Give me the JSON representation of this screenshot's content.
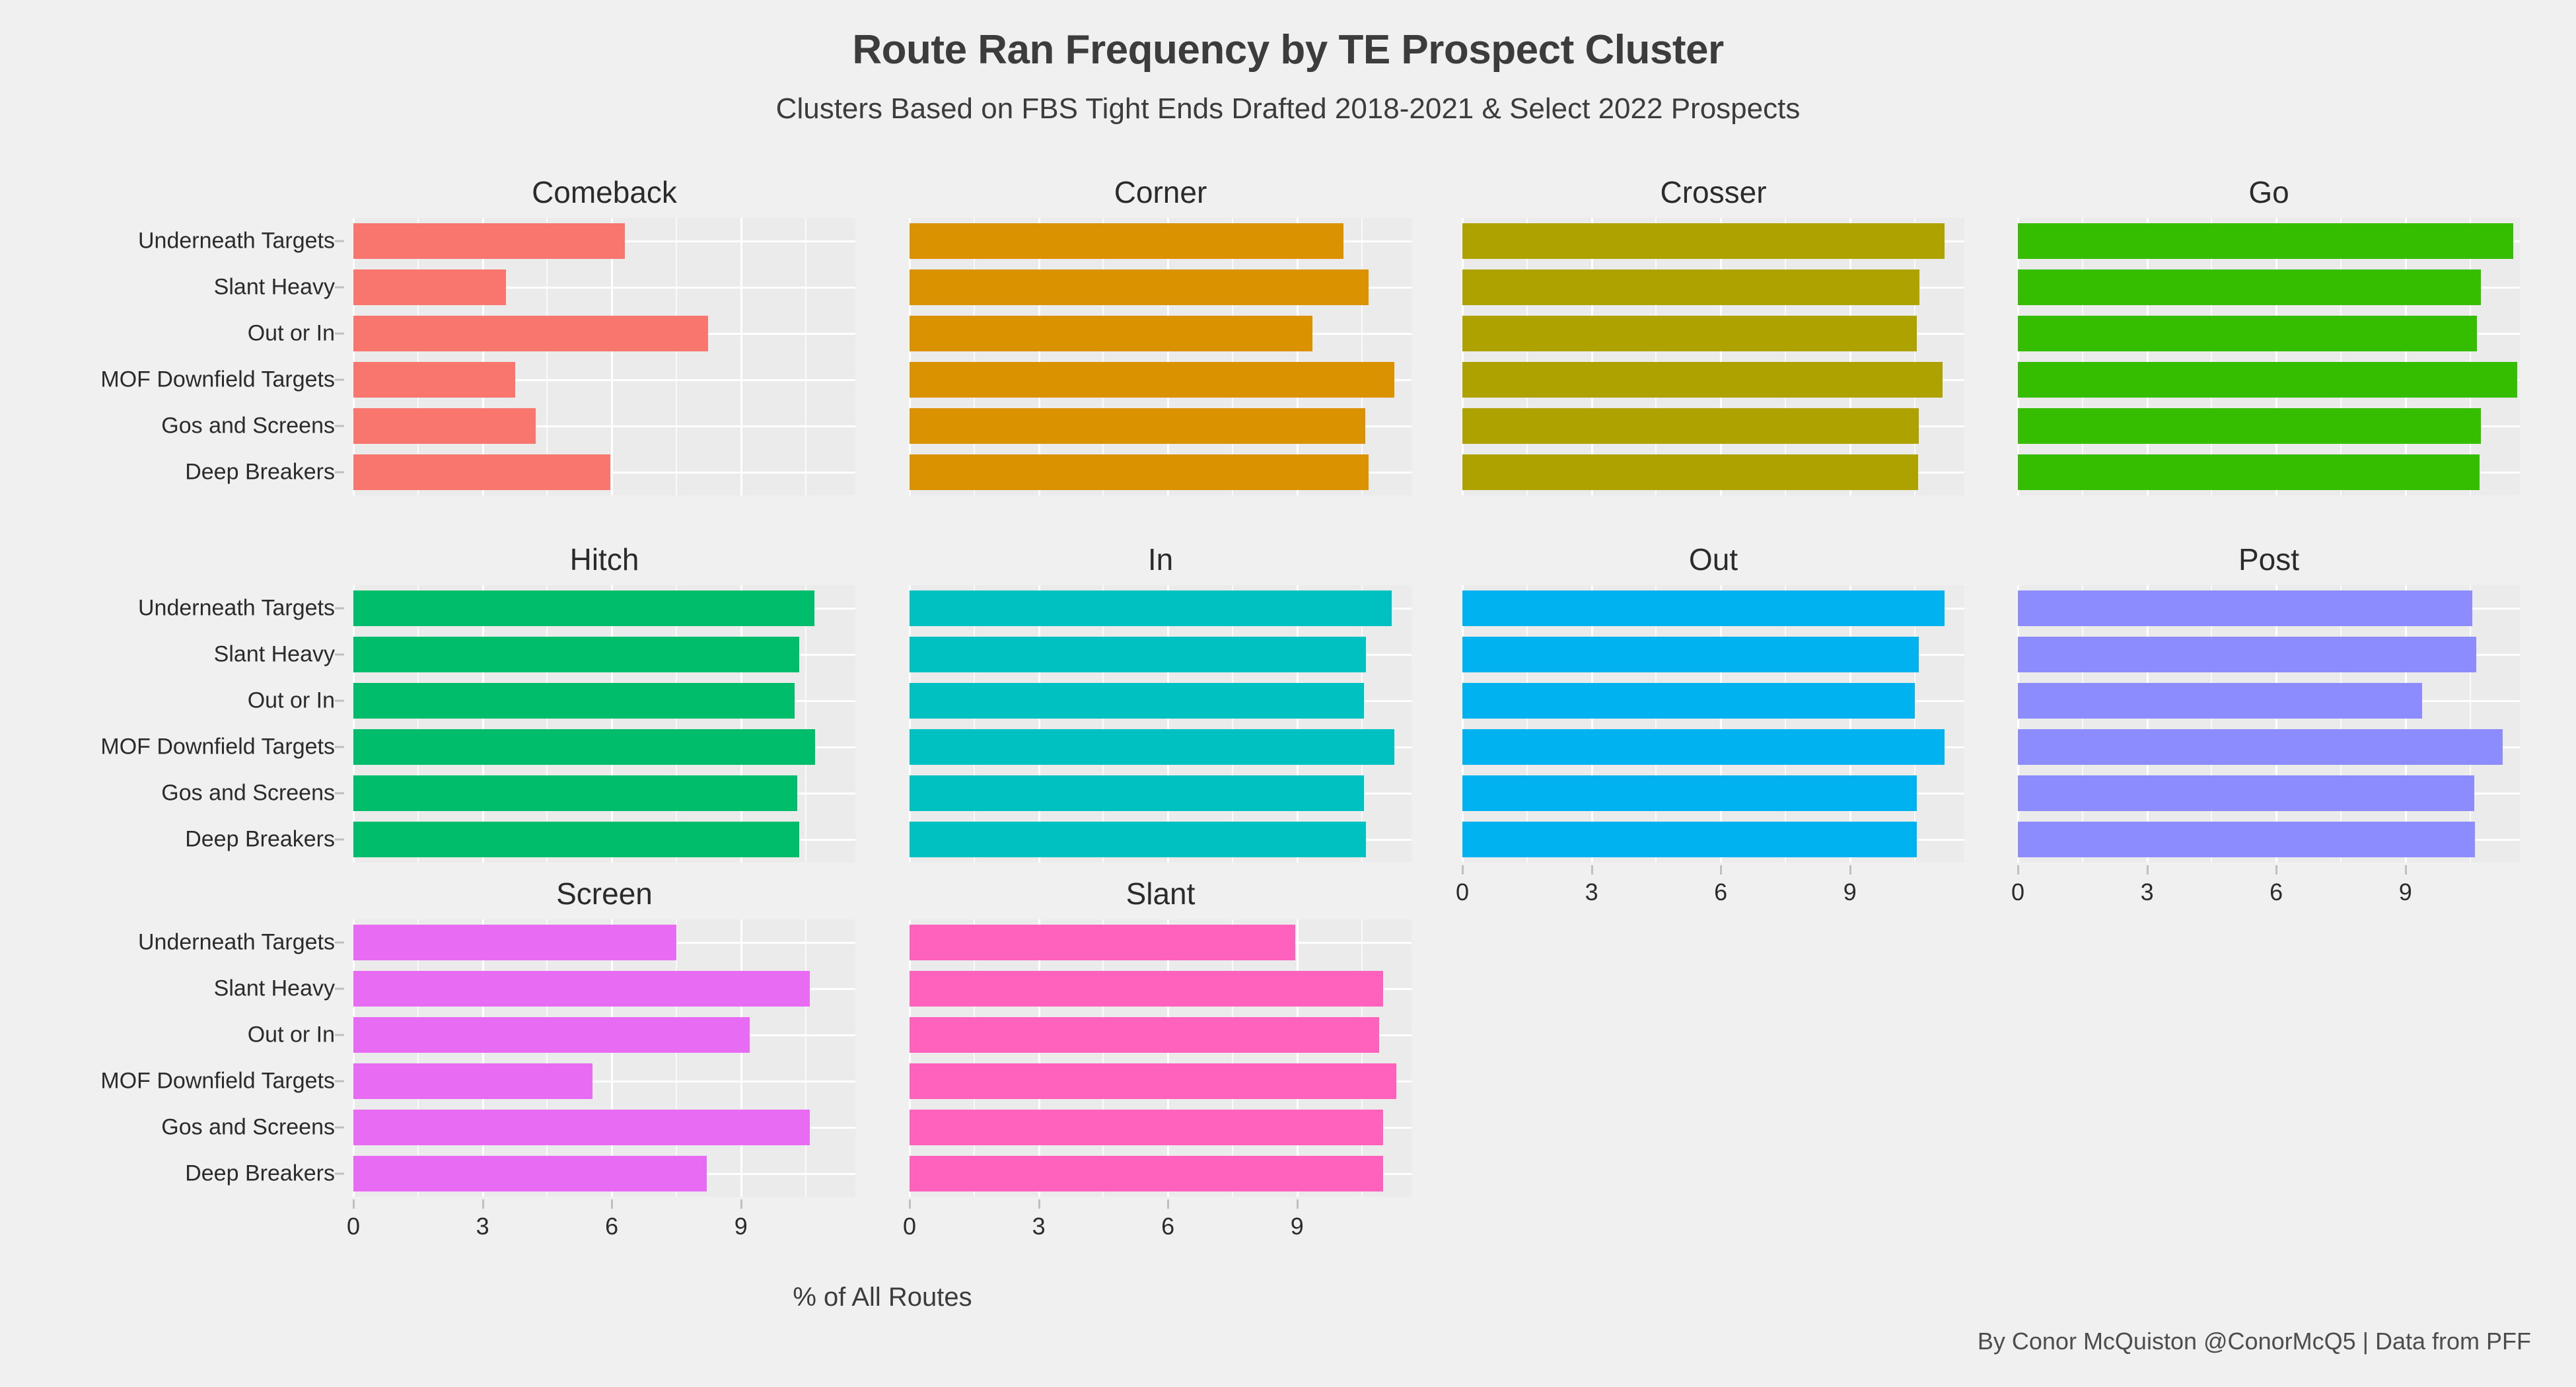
{
  "header": {
    "title": "Route Ran Frequency by TE Prospect Cluster",
    "subtitle": "Clusters Based on FBS Tight Ends Drafted 2018-2021 & Select 2022 Prospects"
  },
  "footer": {
    "caption": "By Conor McQuiston @ConorMcQ5 | Data from PFF"
  },
  "axis": {
    "xlabel": "% of All Routes",
    "ticks": [
      "0",
      "3",
      "6",
      "9"
    ],
    "tick_values": [
      0,
      3,
      6,
      9
    ]
  },
  "chart_data": {
    "type": "bar",
    "orientation": "horizontal",
    "title": "Route Ran Frequency by TE Prospect Cluster",
    "subtitle": "Clusters Based on FBS Tight Ends Drafted 2018-2021 & Select 2022 Prospects",
    "xlabel": "% of All Routes",
    "ylabel": "",
    "xlim": [
      0,
      11.8
    ],
    "xticks": [
      0,
      3,
      6,
      9
    ],
    "grid": true,
    "legend": false,
    "facet_layout": [
      3,
      4
    ],
    "categories": [
      "Underneath Targets",
      "Slant Heavy",
      "Out or In",
      "MOF Downfield Targets",
      "Gos and Screens",
      "Deep Breakers"
    ],
    "panels": [
      {
        "name": "Comeback",
        "color": "#F8766D",
        "row": 0,
        "col": 0,
        "values": [
          6.31,
          3.54,
          8.23,
          3.75,
          4.24,
          5.96
        ]
      },
      {
        "name": "Corner",
        "color": "#DB9200",
        "row": 0,
        "col": 1,
        "values": [
          10.08,
          10.66,
          9.35,
          11.26,
          10.58,
          10.66
        ]
      },
      {
        "name": "Crosser",
        "color": "#AEA200",
        "row": 0,
        "col": 2,
        "values": [
          11.2,
          10.62,
          10.55,
          11.15,
          10.6,
          10.58
        ]
      },
      {
        "name": "Go",
        "color": "#35BE00",
        "row": 0,
        "col": 3,
        "values": [
          11.5,
          10.75,
          10.66,
          11.6,
          10.75,
          10.72
        ]
      },
      {
        "name": "Hitch",
        "color": "#00BD6C",
        "row": 1,
        "col": 0,
        "values": [
          10.7,
          10.35,
          10.25,
          10.72,
          10.3,
          10.35
        ]
      },
      {
        "name": "In",
        "color": "#00C1C1",
        "row": 1,
        "col": 1,
        "values": [
          11.2,
          10.6,
          10.55,
          11.25,
          10.55,
          10.6
        ]
      },
      {
        "name": "Out",
        "color": "#00B3F0",
        "row": 1,
        "col": 2,
        "values": [
          11.2,
          10.6,
          10.5,
          11.2,
          10.55,
          10.55
        ]
      },
      {
        "name": "Post",
        "color": "#8C8CFF",
        "row": 1,
        "col": 3,
        "values": [
          10.55,
          10.65,
          9.38,
          11.25,
          10.6,
          10.62
        ]
      },
      {
        "name": "Screen",
        "color": "#E76BF3",
        "row": 2,
        "col": 0,
        "values": [
          7.5,
          10.6,
          9.2,
          5.55,
          10.6,
          8.2
        ]
      },
      {
        "name": "Slant",
        "color": "#FF62BC",
        "row": 2,
        "col": 1,
        "values": [
          8.95,
          11.0,
          10.9,
          11.3,
          11.0,
          11.0
        ]
      }
    ]
  }
}
